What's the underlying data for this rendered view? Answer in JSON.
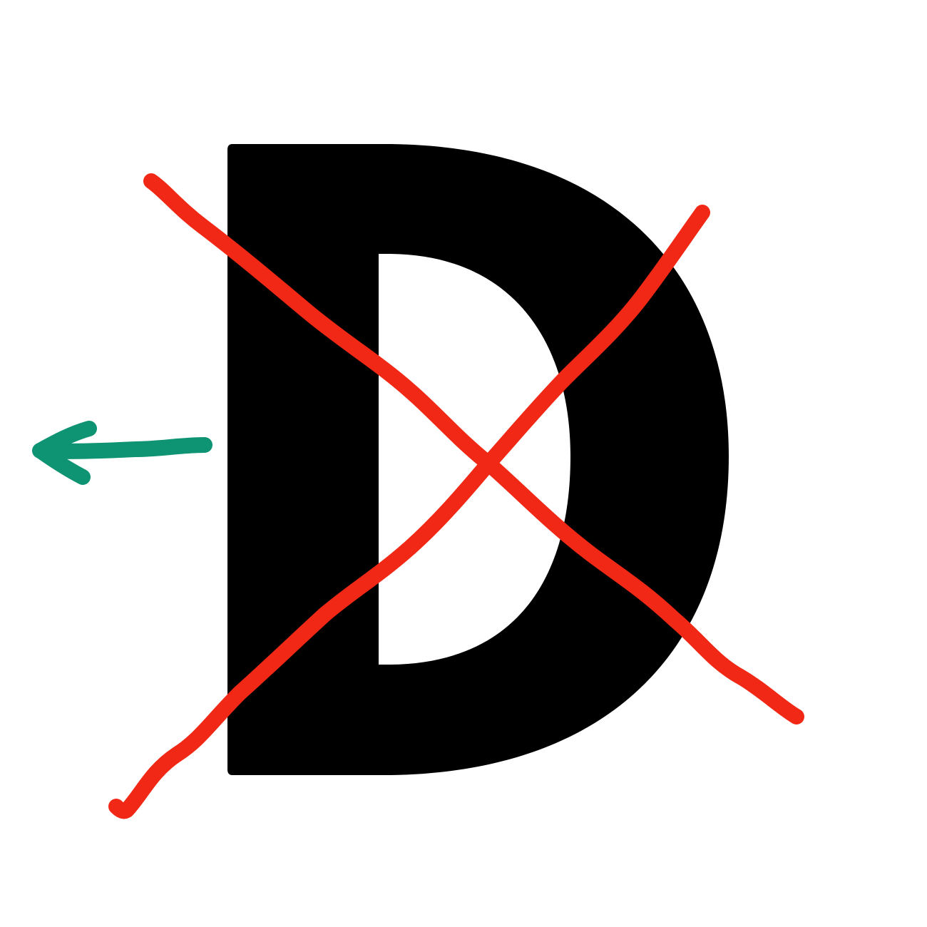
{
  "image": {
    "letter": "D",
    "elements": {
      "letter": {
        "name": "letter-d",
        "color": "#000000"
      },
      "cross": {
        "name": "cross-out-mark",
        "color": "#f02815"
      },
      "arrow": {
        "name": "left-arrow-icon",
        "direction": "left",
        "color": "#0e9473"
      }
    }
  }
}
